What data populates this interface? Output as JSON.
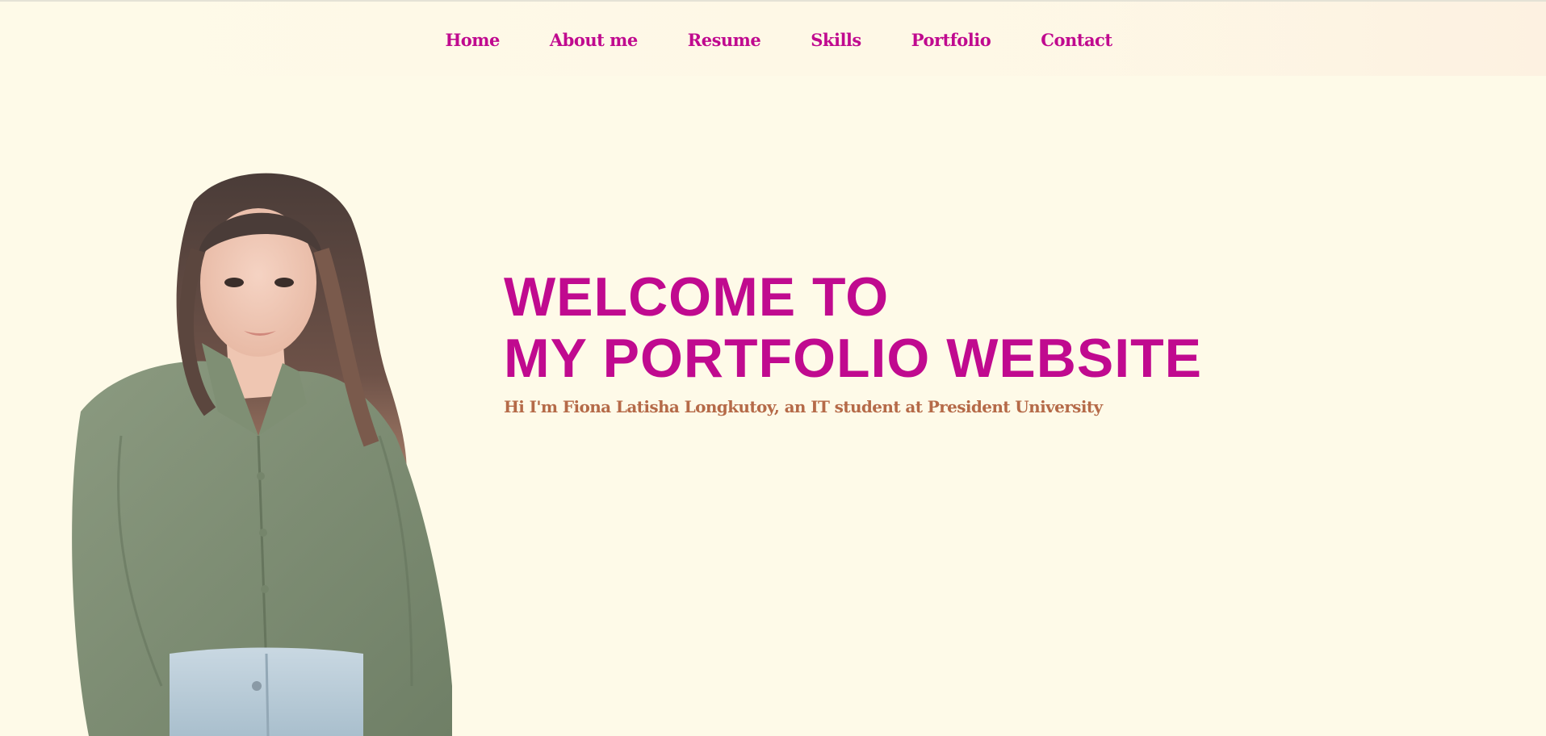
{
  "nav": {
    "items": [
      {
        "label": "Home"
      },
      {
        "label": "About me"
      },
      {
        "label": "Resume"
      },
      {
        "label": "Skills"
      },
      {
        "label": "Portfolio"
      },
      {
        "label": "Contact"
      }
    ]
  },
  "hero": {
    "title_line1": "WELCOME TO",
    "title_line2": "MY PORTFOLIO WEBSITE",
    "subtitle": "Hi I'm Fiona Latisha Longkutoy, an IT student at President University"
  },
  "colors": {
    "background": "#fefae8",
    "accent": "#c00a8f",
    "subtitle": "#b56a48"
  }
}
